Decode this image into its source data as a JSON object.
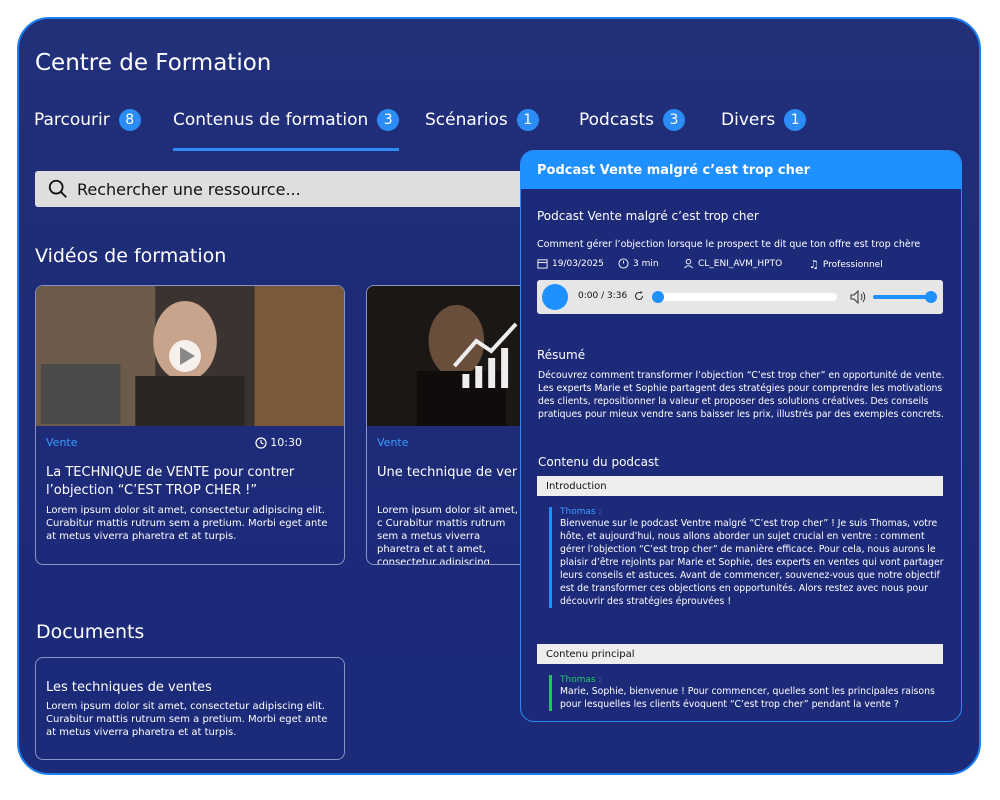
{
  "app": {
    "title": "Centre de Formation"
  },
  "tabs": [
    {
      "label": "Parcourir",
      "count": "8"
    },
    {
      "label": "Contenus de formation",
      "count": "3"
    },
    {
      "label": "Scénarios",
      "count": "1"
    },
    {
      "label": "Podcasts",
      "count": "3"
    },
    {
      "label": "Divers",
      "count": "1"
    }
  ],
  "search": {
    "placeholder": "Rechercher une ressource..."
  },
  "videos": {
    "section_title": "Vidéos de formation",
    "cards": [
      {
        "tag": "Vente",
        "duration": "10:30",
        "title": "La TECHNIQUE de VENTE pour contrer l’objection “C’EST TROP CHER !”",
        "description": "Lorem ipsum dolor sit amet, consectetur adipiscing elit. Curabitur mattis rutrum sem a pretium. Morbi eget ante at metus viverra pharetra et at turpis."
      },
      {
        "tag": "Vente",
        "title": "Une technique de vent",
        "description": "Lorem ipsum dolor sit amet, c Curabitur mattis rutrum sem a metus viverra pharetra et at t amet, consectetur adipiscing"
      }
    ]
  },
  "documents": {
    "section_title": "Documents",
    "items": [
      {
        "title": "Les techniques de ventes",
        "description": "Lorem ipsum dolor sit amet, consectetur adipiscing elit. Curabitur mattis rutrum sem a pretium. Morbi eget ante at metus viverra pharetra et at turpis."
      }
    ]
  },
  "podcast": {
    "header": "Podcast Vente malgré c’est trop cher",
    "title": "Podcast Vente malgré c’est trop cher",
    "subtitle": "Comment gérer l’objection lorsque le prospect te dit que ton offre est trop chère",
    "meta": {
      "date": "19/03/2025",
      "duration": "3 min",
      "code": "CL_ENI_AVM_HPTO",
      "category": "Professionnel"
    },
    "player": {
      "time": "0:00 / 3:36"
    },
    "summary_title": "Résumé",
    "summary": "Découvrez comment transformer l’objection “C’est trop cher” en opportunité de vente. Les experts Marie et Sophie partagent des stratégies pour comprendre les motivations des clients, repositionner la valeur et proposer des solutions créatives. Des conseils pratiques pour mieux vendre sans baisser les prix, illustrés par des exemples concrets.",
    "content_title": "Contenu du podcast",
    "segments": [
      {
        "label": "Introduction",
        "speaker": "Thomas :",
        "text": "Bienvenue sur le podcast Ventre malgré “C’est trop cher” ! Je suis Thomas, votre hôte, et aujourd’hui, nous allons aborder un sujet crucial en ventre : comment gérer l’objection “C’est trop cher” de manière efficace. Pour cela, nous aurons le plaisir d’être rejoints par Marie et Sophie, des experts en ventes qui vont partager leurs conseils et astuces. Avant de commencer, souvenez-vous que notre objectif est de transformer ces objections en opportunités. Alors restez avec nous pour découvrir des stratégies éprouvées !"
      },
      {
        "label": "Contenu principal",
        "speaker": "Thomas :",
        "text": "Marie, Sophie, bienvenue ! Pour commencer, quelles sont les principales raisons pour lesquelles les clients évoquent “C’est trop cher” pendant la vente ?"
      }
    ]
  },
  "colors": {
    "accent": "#1e90ff",
    "background": "#1f2c78",
    "green": "#22c55e"
  }
}
